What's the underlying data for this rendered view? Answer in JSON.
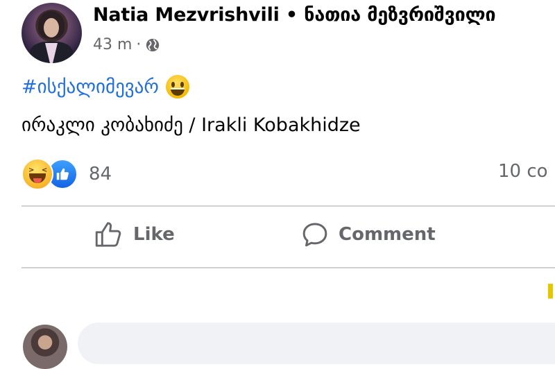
{
  "post": {
    "author": "Natia Mezvrishvili • ნათია მეზვრიშვილი",
    "time": "43 m",
    "separator": "·",
    "privacy_icon": "globe-icon",
    "hashtag": "#ისქალიმევარ",
    "hashtag_emoji": "grinning-face-emoji",
    "text": "ირაკლი კობახიძე / Irakli Kobakhidze"
  },
  "reactions": {
    "icons": [
      "haha-reaction-icon",
      "like-reaction-icon"
    ],
    "count": "84",
    "comments": "10 co"
  },
  "actions": {
    "like_label": "Like",
    "comment_label": "Comment"
  },
  "colors": {
    "link": "#216fdb",
    "secondary_text": "#65676b",
    "divider": "#ced0d4",
    "comment_box": "#f0f2f5"
  }
}
